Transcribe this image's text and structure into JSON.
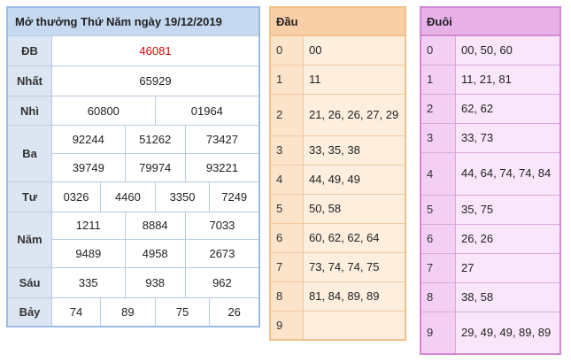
{
  "results": {
    "title": "Mở thưởng Thứ Năm ngày 19/12/2019",
    "db": {
      "label": "ĐB",
      "values": [
        "46081"
      ]
    },
    "nhat": {
      "label": "Nhất",
      "values": [
        "65929"
      ]
    },
    "nhi": {
      "label": "Nhì",
      "values": [
        "60800",
        "01964"
      ]
    },
    "ba": {
      "label": "Ba",
      "values": [
        "92244",
        "51262",
        "73427",
        "39749",
        "79974",
        "93221"
      ]
    },
    "tu": {
      "label": "Tư",
      "values": [
        "0326",
        "4460",
        "3350",
        "7249"
      ]
    },
    "nam": {
      "label": "Năm",
      "values": [
        "1211",
        "8884",
        "7033",
        "9489",
        "4958",
        "2673"
      ]
    },
    "sau": {
      "label": "Sáu",
      "values": [
        "335",
        "938",
        "962"
      ]
    },
    "bay": {
      "label": "Bảy",
      "values": [
        "74",
        "89",
        "75",
        "26"
      ]
    }
  },
  "dau": {
    "title": "Đầu",
    "rows": [
      {
        "key": "0",
        "value": "00"
      },
      {
        "key": "1",
        "value": "11"
      },
      {
        "key": "2",
        "value": "21, 26, 26, 27, 29"
      },
      {
        "key": "3",
        "value": "33, 35, 38"
      },
      {
        "key": "4",
        "value": "44, 49, 49"
      },
      {
        "key": "5",
        "value": "50, 58"
      },
      {
        "key": "6",
        "value": "60, 62, 62, 64"
      },
      {
        "key": "7",
        "value": "73, 74, 74, 75"
      },
      {
        "key": "8",
        "value": "81, 84, 89, 89"
      },
      {
        "key": "9",
        "value": ""
      }
    ]
  },
  "duoi": {
    "title": "Đuôi",
    "rows": [
      {
        "key": "0",
        "value": "00, 50, 60"
      },
      {
        "key": "1",
        "value": "11, 21, 81"
      },
      {
        "key": "2",
        "value": "62, 62"
      },
      {
        "key": "3",
        "value": "33, 73"
      },
      {
        "key": "4",
        "value": "44, 64, 74, 74, 84"
      },
      {
        "key": "5",
        "value": "35, 75"
      },
      {
        "key": "6",
        "value": "26, 26"
      },
      {
        "key": "7",
        "value": "27"
      },
      {
        "key": "8",
        "value": "38, 58"
      },
      {
        "key": "9",
        "value": "29, 49, 49, 89, 89"
      }
    ]
  },
  "colors": {
    "special_prize": "#e00000",
    "results_border": "#9bbce6",
    "dau_border": "#f3c08a",
    "duoi_border": "#d18ad1"
  }
}
